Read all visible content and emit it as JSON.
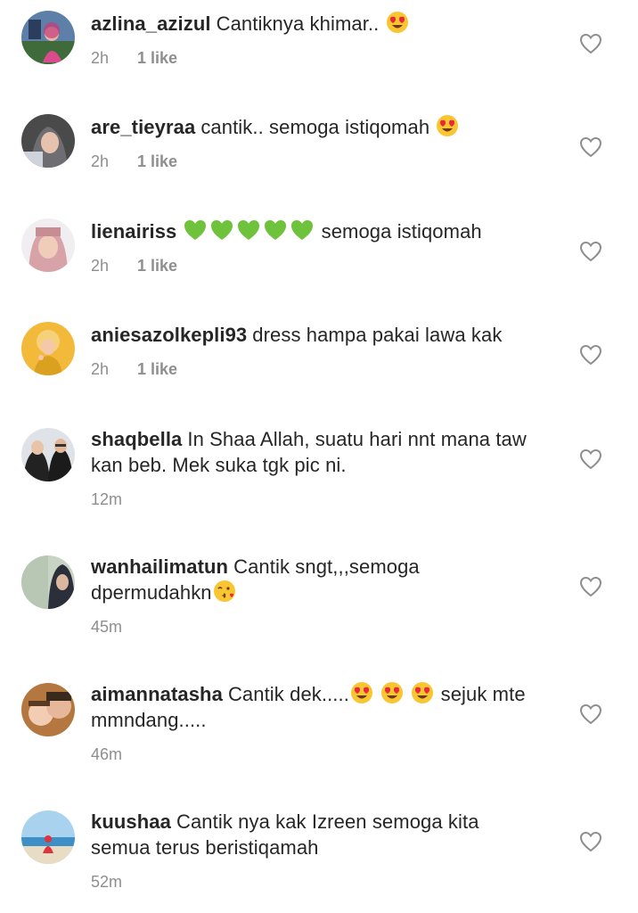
{
  "comments": [
    {
      "username": "azlina_azizul",
      "text": "Cantiknya khimar..",
      "emoji_after": [
        "heart-eyes"
      ],
      "trailing_text": "",
      "time": "2h",
      "likes": "1 like",
      "avatar": "avatar-1"
    },
    {
      "username": "are_tieyraa",
      "text": "cantik.. semoga istiqomah",
      "emoji_after": [
        "heart-eyes"
      ],
      "trailing_text": "",
      "time": "2h",
      "likes": "1 like",
      "avatar": "avatar-2"
    },
    {
      "username": "lienairiss",
      "text": "",
      "emoji_after": [
        "green-heart",
        "green-heart",
        "green-heart",
        "green-heart",
        "green-heart"
      ],
      "trailing_text": "semoga istiqomah",
      "time": "2h",
      "likes": "1 like",
      "avatar": "avatar-3"
    },
    {
      "username": "aniesazolkepli93",
      "text": "dress hampa pakai lawa kak",
      "emoji_after": [],
      "trailing_text": "",
      "time": "2h",
      "likes": "1 like",
      "avatar": "avatar-4"
    },
    {
      "username": "shaqbella",
      "text": "In Shaa Allah, suatu hari nnt mana taw kan beb. Mek suka tgk pic ni.",
      "emoji_after": [],
      "trailing_text": "",
      "time": "12m",
      "likes": "",
      "avatar": "avatar-5"
    },
    {
      "username": "wanhailimatun",
      "text": "Cantik sngt,,,semoga dpermudahkn",
      "emoji_after": [
        "kissing-face"
      ],
      "trailing_text": "",
      "time": "45m",
      "likes": "",
      "avatar": "avatar-6"
    },
    {
      "username": "aimannatasha",
      "text": "Cantik dek.....",
      "emoji_after": [
        "heart-eyes",
        "heart-eyes",
        "heart-eyes"
      ],
      "trailing_text": "sejuk mte mmndang.....",
      "time": "46m",
      "likes": "",
      "avatar": "avatar-7"
    },
    {
      "username": "kuushaa",
      "text": "Cantik nya kak Izreen semoga kita semua terus beristiqamah",
      "emoji_after": [],
      "trailing_text": "",
      "time": "52m",
      "likes": "",
      "avatar": "avatar-8"
    }
  ],
  "icons": {
    "like": "heart-outline-icon"
  },
  "colors": {
    "username": "#262626",
    "meta": "#8e8e8e",
    "heart_outline": "#8e8e8e"
  }
}
